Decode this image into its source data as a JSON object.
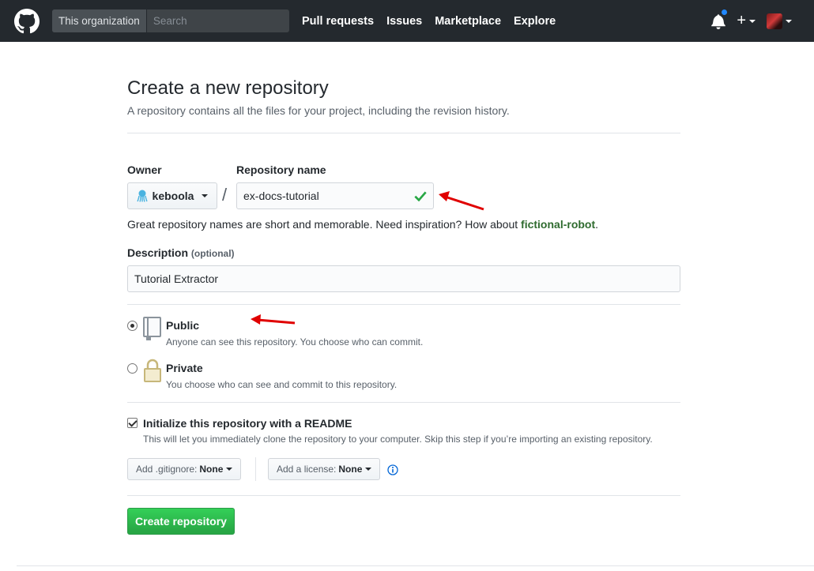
{
  "header": {
    "search_scope": "This organization",
    "search_placeholder": "Search",
    "nav": [
      "Pull requests",
      "Issues",
      "Marketplace",
      "Explore"
    ],
    "plus_label": "+"
  },
  "page": {
    "title": "Create a new repository",
    "subtitle": "A repository contains all the files for your project, including the revision history."
  },
  "form": {
    "owner_label": "Owner",
    "owner_value": "keboola",
    "separator": "/",
    "repo_label": "Repository name",
    "repo_value": "ex-docs-tutorial",
    "hint_text": "Great repository names are short and memorable. Need inspiration? How about ",
    "hint_suggestion": "fictional-robot",
    "hint_end": ".",
    "description_label": "Description",
    "description_optional": "(optional)",
    "description_value": "Tutorial Extractor"
  },
  "visibility": {
    "public_title": "Public",
    "public_note": "Anyone can see this repository. You choose who can commit.",
    "private_title": "Private",
    "private_note": "You choose who can see and commit to this repository.",
    "selected": "public"
  },
  "init": {
    "readme_title": "Initialize this repository with a README",
    "readme_note": "This will let you immediately clone the repository to your computer. Skip this step if you’re importing an existing repository.",
    "readme_checked": true,
    "gitignore_label": "Add .gitignore:",
    "gitignore_value": "None",
    "license_label": "Add a license:",
    "license_value": "None"
  },
  "submit": {
    "label": "Create repository"
  },
  "colors": {
    "header_bg": "#24292e",
    "primary_green": "#28a745",
    "annotation_red": "#e00000",
    "check_green": "#28a745",
    "info_blue": "#0366d6"
  }
}
